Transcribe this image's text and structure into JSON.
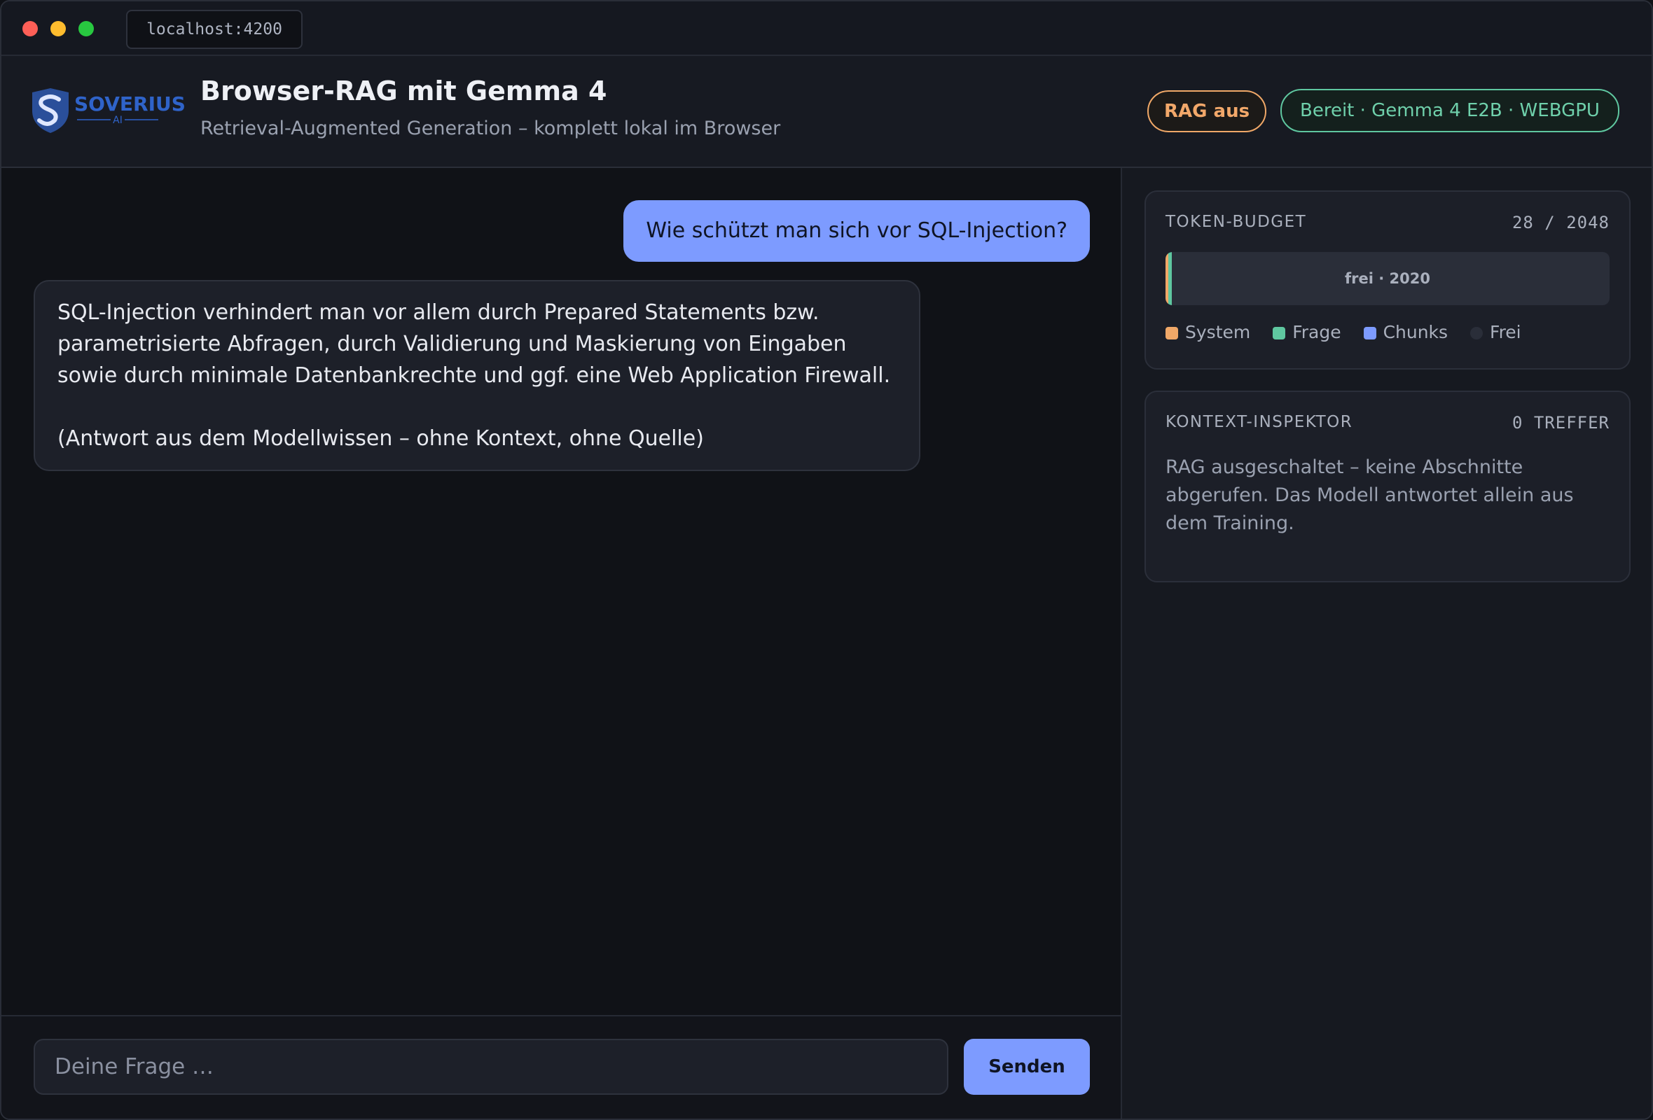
{
  "browser": {
    "url": "localhost:4200"
  },
  "header": {
    "logo_text": "SOVERIUS",
    "logo_subtext": "AI",
    "title": "Browser-RAG mit Gemma 4",
    "subtitle": "Retrieval-Augmented Generation – komplett lokal im Browser",
    "rag_badge": "RAG aus",
    "status_badge": "Bereit · Gemma 4 E2B · WEBGPU"
  },
  "chat": {
    "messages": [
      {
        "role": "user",
        "text": "Wie schützt man sich vor SQL-Injection?"
      },
      {
        "role": "assistant",
        "paragraphs": [
          "SQL-Injection verhindert man vor allem durch Prepared Statements bzw. parametrisierte Abfragen, durch Validierung und Maskierung von Eingaben sowie durch minimale Datenbankrechte und ggf. eine Web Application Firewall.",
          "(Antwort aus dem Modellwissen – ohne Kontext, ohne Quelle)"
        ]
      }
    ],
    "input_placeholder": "Deine Frage …",
    "input_value": "",
    "send_label": "Senden"
  },
  "token_budget": {
    "label": "TOKEN-BUDGET",
    "used": 28,
    "total": 2048,
    "meta": "28 / 2048",
    "bar_text": "frei · 2020",
    "legend": [
      {
        "label": "System",
        "color": "#f0a868"
      },
      {
        "label": "Frage",
        "color": "#5fc7a0"
      },
      {
        "label": "Chunks",
        "color": "#7d9bff"
      },
      {
        "label": "Frei",
        "color": "#2a2e39"
      }
    ]
  },
  "context_inspector": {
    "label": "KONTEXT-INSPEKTOR",
    "meta": "0 TREFFER",
    "text": "RAG ausgeschaltet – keine Abschnitte abgerufen. Das Modell antwortet allein aus dem Training."
  },
  "colors": {
    "accent": "#7d9bff",
    "rag_off": "#f0a868",
    "ready": "#5fc7a0"
  }
}
